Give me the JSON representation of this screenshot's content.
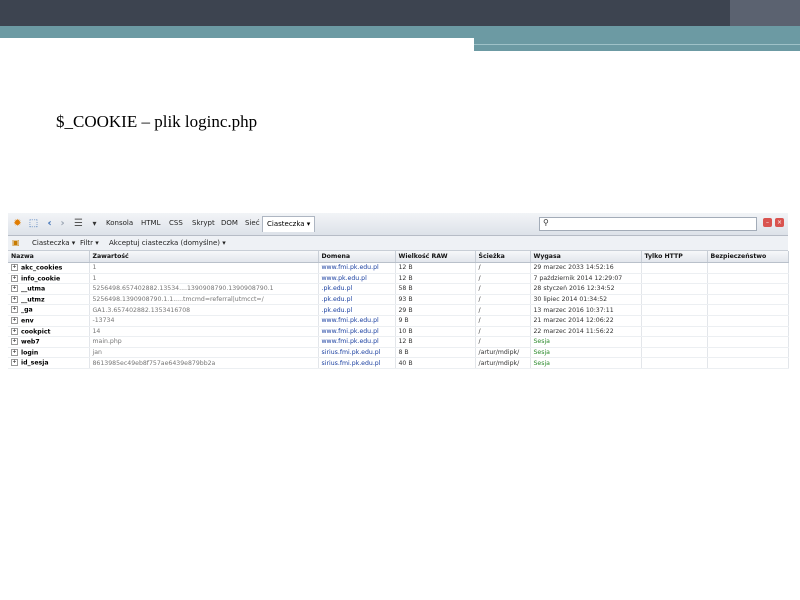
{
  "slide": {
    "title": "$_COOKIE – plik loginc.php"
  },
  "toolbar": {
    "tabs": [
      "Konsola",
      "HTML",
      "CSS",
      "Skrypt",
      "DOM",
      "Sieć"
    ],
    "active_tab": "Ciasteczka ▾",
    "search_placeholder": ""
  },
  "subbar": {
    "cookies_menu": "Ciasteczka ▾",
    "filter_menu": "Filtr ▾",
    "accept_menu": "Akceptuj ciasteczka (domyślne) ▾"
  },
  "table": {
    "headers": [
      "Nazwa",
      "Zawartość",
      "Domena",
      "Wielkość RAW",
      "Ścieżka",
      "Wygasa",
      "Tylko HTTP",
      "Bezpieczeństwo"
    ],
    "rows": [
      [
        "akc_cookies",
        "1",
        "www.fmi.pk.edu.pl",
        "12 B",
        "/",
        "29 marzec 2033 14:52:16",
        "",
        ""
      ],
      [
        "info_cookie",
        "1",
        "www.pk.edu.pl",
        "12 B",
        "/",
        "7 październik 2014 12:29:07",
        "",
        ""
      ],
      [
        "__utma",
        "5256498.657402882.13534....1390908790.1390908790.1",
        ".pk.edu.pl",
        "58 B",
        "/",
        "28 styczeń 2016 12:34:52",
        "",
        ""
      ],
      [
        "__utmz",
        "5256498.1390908790.1.1.....tmcmd=referral|utmcct=/",
        ".pk.edu.pl",
        "93 B",
        "/",
        "30 lipiec 2014 01:34:52",
        "",
        ""
      ],
      [
        "_ga",
        "GA1.3.657402882.1353416708",
        ".pk.edu.pl",
        "29 B",
        "/",
        "13 marzec 2016 10:37:11",
        "",
        ""
      ],
      [
        "env",
        "-13734",
        "www.fmi.pk.edu.pl",
        "9 B",
        "/",
        "21 marzec 2014 12:06:22",
        "",
        ""
      ],
      [
        "cookpict",
        "14",
        "www.fmi.pk.edu.pl",
        "10 B",
        "/",
        "22 marzec 2014 11:56:22",
        "",
        ""
      ],
      [
        "web7",
        "main.php",
        "www.fmi.pk.edu.pl",
        "12 B",
        "/",
        "Sesja",
        "",
        ""
      ],
      [
        "login",
        "jan",
        "sirius.fmi.pk.edu.pl",
        "8 B",
        "/artur/mdipk/",
        "Sesja",
        "",
        ""
      ],
      [
        "id_sesja",
        "8613985ec49eb8f757ae6439e879bb2a",
        "sirius.fmi.pk.edu.pl",
        "40 B",
        "/artur/mdipk/",
        "Sesja",
        "",
        ""
      ]
    ]
  }
}
